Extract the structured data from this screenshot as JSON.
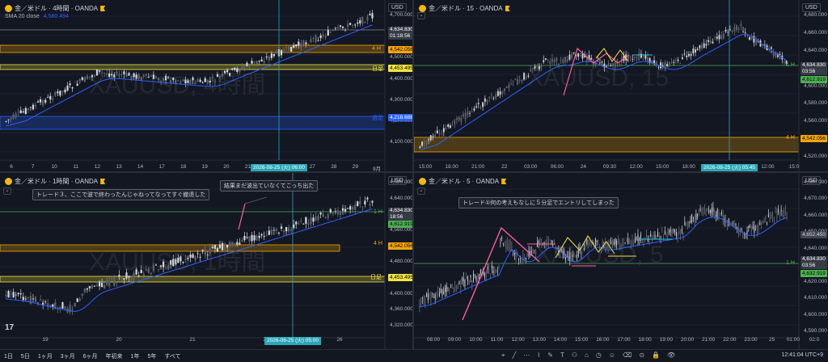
{
  "panes": [
    {
      "id": "tl",
      "title": "金／米ドル · 4時間 · OANDA",
      "sma": {
        "label": "SMA 20 close",
        "value": "4,580.494"
      },
      "watermark": "XAUUSD, 4時間",
      "currency": "USD",
      "yticks": [
        "4,700.000",
        "4,600.000",
        "4,500.000",
        "4,400.000",
        "4,300.000",
        "4,200.000",
        "4,100.000"
      ],
      "xticks": [
        "6",
        "7",
        "10",
        "11",
        "12",
        "13",
        "14",
        "17",
        "18",
        "19",
        "20",
        "21",
        "24",
        "26",
        "27",
        "28",
        "29",
        "9月"
      ],
      "date_label": "2026-08-25 (火)  06:00",
      "price_labels": [
        {
          "text": "4,634.830",
          "sub": "01:18:56",
          "kind": "current"
        },
        {
          "text": "4,542.056",
          "kind": "orange"
        },
        {
          "text": "4,453.495",
          "kind": "yellow"
        },
        {
          "text": "4,218.688",
          "kind": "blue"
        }
      ],
      "zone_labels": [
        "4 H",
        "日足",
        "週足"
      ]
    },
    {
      "id": "tr",
      "title": "金／米ドル · 15 · OANDA",
      "watermark": "XAUUSD, 15",
      "currency": "USD",
      "yticks": [
        "4,680.000",
        "4,660.000",
        "4,640.000",
        "4,620.000",
        "4,600.000",
        "4,580.000",
        "4,560.000",
        "4,540.000",
        "4,520.000"
      ],
      "xticks": [
        "15:00",
        "18:00",
        "21:00",
        "22",
        "03:00",
        "06:00",
        "24",
        "09:30",
        "12:00",
        "15:00",
        "18:00",
        "21:00",
        "25",
        "12:00",
        "15:0"
      ],
      "date_label": "2026-08-25 (火)  05:45",
      "price_labels": [
        {
          "text": "4,634.830",
          "sub": "03:56",
          "kind": "current"
        },
        {
          "text": "4,612.919",
          "kind": "green"
        },
        {
          "text": "4,542.056",
          "kind": "orange"
        }
      ],
      "zone_labels": [
        "1 H",
        "4 H"
      ]
    },
    {
      "id": "bl",
      "title": "金／米ドル · 1時間 · OANDA",
      "watermark": "XAUUSD, 1時間",
      "currency": "USD",
      "yticks": [
        "4,680.000",
        "4,640.000",
        "4,600.000",
        "4,560.000",
        "4,520.000",
        "4,480.000",
        "4,440.000",
        "4,400.000",
        "4,360.000",
        "4,320.000"
      ],
      "xticks": [
        "19",
        "20",
        "21",
        "22",
        "26"
      ],
      "date_label": "2026-08-25 (火)  05:00",
      "price_labels": [
        {
          "text": "4,634.830",
          "sub": "18:56",
          "kind": "current"
        },
        {
          "text": "4,612.919",
          "kind": "green"
        },
        {
          "text": "4,542.056",
          "kind": "orange"
        },
        {
          "text": "4,453.495",
          "kind": "yellow"
        }
      ],
      "zone_labels": [
        "1 H",
        "4 H",
        "日足"
      ],
      "notes": [
        "トレード３、ここで波で終わったんじゃねってなってすぐ撤退した",
        "結果まだ波出ていなくてこっち出た"
      ]
    },
    {
      "id": "br",
      "title": "金／米ドル · 5 · OANDA",
      "watermark": "XAUUSD, 5",
      "currency": "USD",
      "yticks": [
        "4,680.000",
        "4,670.000",
        "4,660.000",
        "4,650.000",
        "4,640.000",
        "4,630.000",
        "4,620.000",
        "4,610.000",
        "4,600.000",
        "4,590.000"
      ],
      "xticks": [
        "08:00",
        "09:00",
        "10:00",
        "11:00",
        "12:00",
        "13:00",
        "14:00",
        "15:00",
        "16:00",
        "17:00",
        "18:00",
        "19:00",
        "20:00",
        "21:00",
        "22:00",
        "23:00",
        "25",
        "01:00",
        "02:0"
      ],
      "price_labels": [
        {
          "text": "4,652.450",
          "kind": "grey"
        },
        {
          "text": "4,634.830",
          "sub": "03:56",
          "kind": "current"
        },
        {
          "text": "4,632.919",
          "kind": "green"
        }
      ],
      "zone_labels": [
        "1 H"
      ],
      "notes": [
        "トレード①何の考えもなしに５分足でエントリしてしまった"
      ]
    }
  ],
  "bottom_bar": {
    "timeframes": [
      "1日",
      "5日",
      "1ヶ月",
      "3ヶ月",
      "6ヶ月",
      "年初来",
      "1年",
      "5年",
      "すべて"
    ],
    "tools": [
      "⌖",
      "╱",
      "⋯",
      "⌇",
      "✎",
      "T",
      "⚇",
      "⌂",
      "◷",
      "☺",
      "⌫",
      "⊙",
      "🔒",
      "👁"
    ],
    "clock": "12:41:04 UTC+9"
  },
  "colors": {
    "bg": "#131722",
    "up": "#d1d4dc",
    "down": "#787b86",
    "sma": "#2962ff",
    "orange": "#f7a600",
    "yellow": "#f0e442",
    "blue": "#2962ff",
    "green": "#4caf50",
    "cross": "#2aa7b8",
    "pink": "#ff5e9a"
  }
}
